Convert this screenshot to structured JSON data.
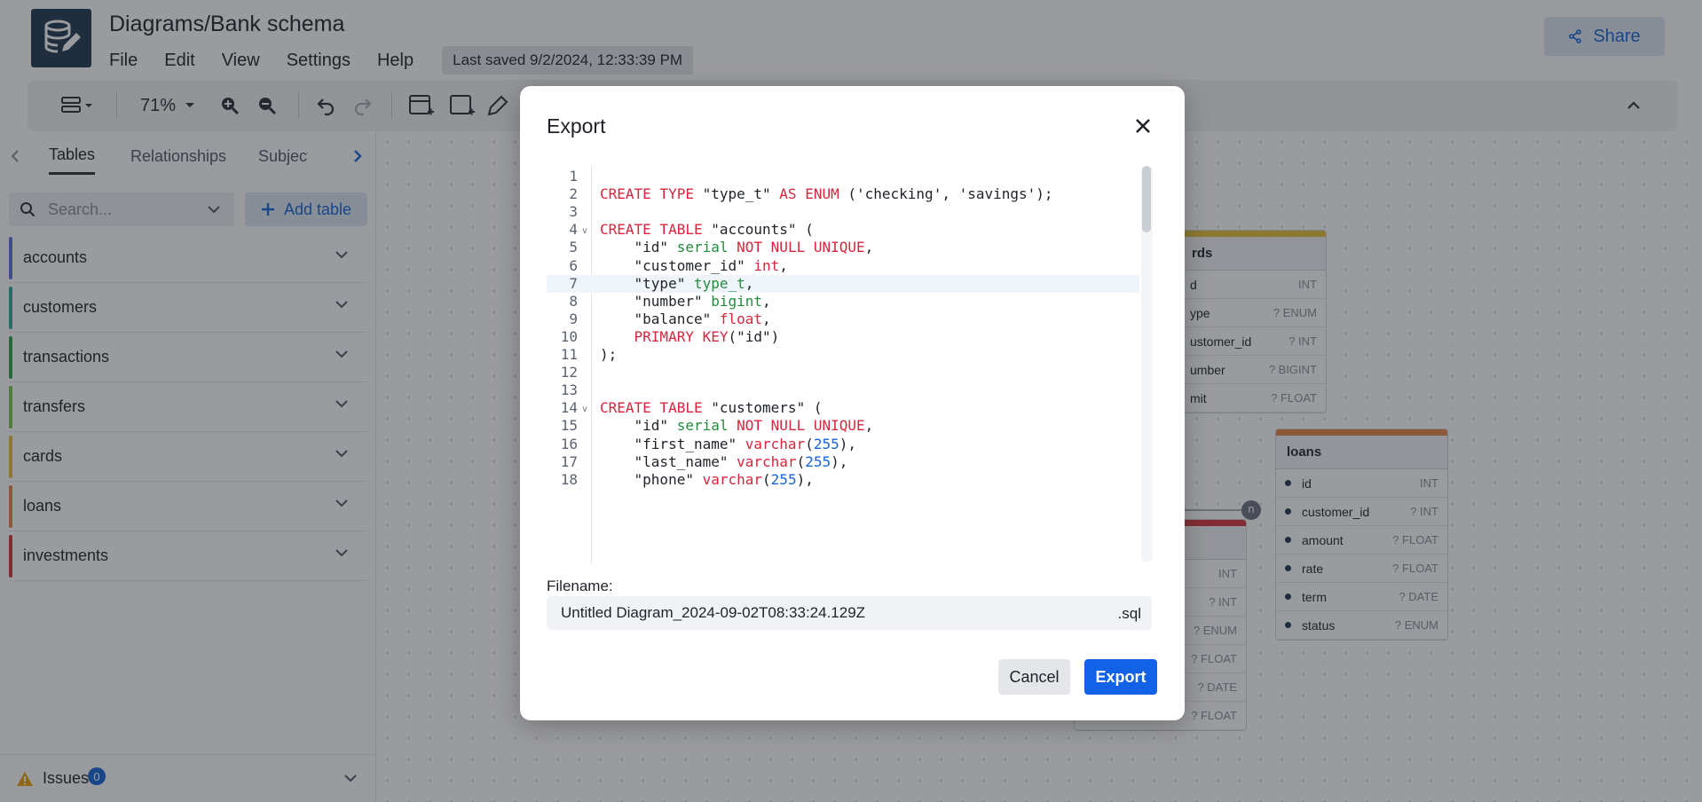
{
  "app": {
    "title": "Diagrams/Bank schema",
    "menu": [
      "File",
      "Edit",
      "View",
      "Settings",
      "Help"
    ],
    "last_saved": "Last saved 9/2/2024, 12:33:39 PM",
    "share_label": "Share"
  },
  "toolbar": {
    "zoom": "71%"
  },
  "sidebar": {
    "tabs": [
      "Tables",
      "Relationships",
      "Subject are"
    ],
    "search_placeholder": "Search...",
    "add_table_label": "Add table",
    "tables": [
      {
        "name": "accounts",
        "color": "#5b6fd8"
      },
      {
        "name": "customers",
        "color": "#2eaa9e"
      },
      {
        "name": "transactions",
        "color": "#2fa34a"
      },
      {
        "name": "transfers",
        "color": "#79c54a"
      },
      {
        "name": "cards",
        "color": "#e3c13a"
      },
      {
        "name": "loans",
        "color": "#e8834a"
      },
      {
        "name": "investments",
        "color": "#d6383c"
      }
    ],
    "issues_label": "Issues",
    "issues_count": "0"
  },
  "canvas": {
    "cards_table": {
      "title": "rds",
      "color": "#e3c13a",
      "fields": [
        {
          "name": "d",
          "type": "INT"
        },
        {
          "name": "ype",
          "type": "? ENUM"
        },
        {
          "name": "ustomer_id",
          "type": "? INT"
        },
        {
          "name": "umber",
          "type": "? BIGINT"
        },
        {
          "name": "mit",
          "type": "? FLOAT"
        }
      ]
    },
    "loans_table": {
      "title": "loans",
      "color": "#e8834a",
      "fields": [
        {
          "name": "id",
          "type": "INT"
        },
        {
          "name": "customer_id",
          "type": "? INT"
        },
        {
          "name": "amount",
          "type": "? FLOAT"
        },
        {
          "name": "rate",
          "type": "? FLOAT"
        },
        {
          "name": "term",
          "type": "? DATE"
        },
        {
          "name": "status",
          "type": "? ENUM"
        }
      ]
    },
    "partial_table": {
      "color": "#d6383c",
      "fields": [
        {
          "type": "INT"
        },
        {
          "type": "? INT"
        },
        {
          "type": "? ENUM"
        },
        {
          "type": "? FLOAT"
        },
        {
          "type": "? DATE"
        },
        {
          "type": "? FLOAT"
        }
      ]
    },
    "relationship_label": "n"
  },
  "export_modal": {
    "title": "Export",
    "code_lines": [
      {
        "n": "1",
        "fold": "",
        "active": false,
        "tokens": []
      },
      {
        "n": "2",
        "fold": "",
        "active": false,
        "tokens": [
          [
            "kw",
            "CREATE TYPE "
          ],
          [
            "",
            "\"type_t\" "
          ],
          [
            "kw",
            "AS ENUM "
          ],
          [
            "",
            "('checking', 'savings');"
          ]
        ]
      },
      {
        "n": "3",
        "fold": "",
        "active": false,
        "tokens": []
      },
      {
        "n": "4",
        "fold": "v",
        "active": false,
        "tokens": [
          [
            "kw",
            "CREATE TABLE "
          ],
          [
            "",
            "\"accounts\" ("
          ]
        ]
      },
      {
        "n": "5",
        "fold": "",
        "active": false,
        "tokens": [
          [
            "",
            "    \"id\" "
          ],
          [
            "ty",
            "serial "
          ],
          [
            "kw",
            "NOT NULL UNIQUE"
          ],
          [
            "",
            ","
          ]
        ]
      },
      {
        "n": "6",
        "fold": "",
        "active": false,
        "tokens": [
          [
            "",
            "    \"customer_id\" "
          ],
          [
            "kw",
            "int"
          ],
          [
            "",
            ","
          ]
        ]
      },
      {
        "n": "7",
        "fold": "",
        "active": true,
        "tokens": [
          [
            "",
            "    \"type\" "
          ],
          [
            "ty",
            "type_t"
          ],
          [
            "",
            ","
          ]
        ]
      },
      {
        "n": "8",
        "fold": "",
        "active": false,
        "tokens": [
          [
            "",
            "    \"number\" "
          ],
          [
            "ty",
            "bigint"
          ],
          [
            "",
            ","
          ]
        ]
      },
      {
        "n": "9",
        "fold": "",
        "active": false,
        "tokens": [
          [
            "",
            "    \"balance\" "
          ],
          [
            "kw",
            "float"
          ],
          [
            "",
            ","
          ]
        ]
      },
      {
        "n": "10",
        "fold": "",
        "active": false,
        "tokens": [
          [
            "kw",
            "    PRIMARY KEY"
          ],
          [
            "",
            "(\"id\")"
          ]
        ]
      },
      {
        "n": "11",
        "fold": "",
        "active": false,
        "tokens": [
          [
            "",
            ");"
          ]
        ]
      },
      {
        "n": "12",
        "fold": "",
        "active": false,
        "tokens": []
      },
      {
        "n": "13",
        "fold": "",
        "active": false,
        "tokens": []
      },
      {
        "n": "14",
        "fold": "v",
        "active": false,
        "tokens": [
          [
            "kw",
            "CREATE TABLE "
          ],
          [
            "",
            "\"customers\" ("
          ]
        ]
      },
      {
        "n": "15",
        "fold": "",
        "active": false,
        "tokens": [
          [
            "",
            "    \"id\" "
          ],
          [
            "ty",
            "serial "
          ],
          [
            "kw",
            "NOT NULL UNIQUE"
          ],
          [
            "",
            ","
          ]
        ]
      },
      {
        "n": "16",
        "fold": "",
        "active": false,
        "tokens": [
          [
            "",
            "    \"first_name\" "
          ],
          [
            "kw",
            "varchar"
          ],
          [
            "",
            "("
          ],
          [
            "num",
            "255"
          ],
          [
            "",
            "),"
          ]
        ]
      },
      {
        "n": "17",
        "fold": "",
        "active": false,
        "tokens": [
          [
            "",
            "    \"last_name\" "
          ],
          [
            "kw",
            "varchar"
          ],
          [
            "",
            "("
          ],
          [
            "num",
            "255"
          ],
          [
            "",
            "),"
          ]
        ]
      },
      {
        "n": "18",
        "fold": "",
        "active": false,
        "tokens": [
          [
            "",
            "    \"phone\" "
          ],
          [
            "kw",
            "varchar"
          ],
          [
            "",
            "("
          ],
          [
            "num",
            "255"
          ],
          [
            "",
            "),"
          ]
        ]
      }
    ],
    "filename_label": "Filename:",
    "filename_value": "Untitled Diagram_2024-09-02T08:33:24.129Z",
    "filename_ext": ".sql",
    "cancel_label": "Cancel",
    "export_label": "Export"
  }
}
